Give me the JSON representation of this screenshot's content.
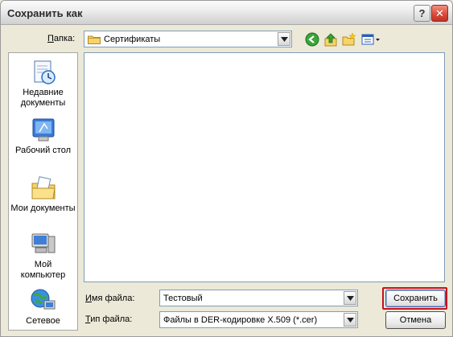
{
  "window": {
    "title": "Сохранить как"
  },
  "folder": {
    "label_prefix": "",
    "label_accel": "П",
    "label_rest": "апка:",
    "value": "Сертификаты"
  },
  "toolbar": {
    "icons": [
      "back-icon",
      "up-folder-icon",
      "new-folder-icon",
      "view-menu-icon"
    ]
  },
  "places": [
    {
      "label_line1": "Недавние",
      "label_line2": "документы",
      "icon": "recent-documents-icon"
    },
    {
      "label_line1": "Рабочий стол",
      "label_line2": "",
      "icon": "desktop-icon"
    },
    {
      "label_line1": "Мои документы",
      "label_line2": "",
      "icon": "my-documents-icon"
    },
    {
      "label_line1": "Мой",
      "label_line2": "компьютер",
      "icon": "my-computer-icon"
    },
    {
      "label_line1": "Сетевое",
      "label_line2": "",
      "icon": "network-icon"
    }
  ],
  "filename": {
    "label_accel": "И",
    "label_rest": "мя файла:",
    "value": "Тестовый"
  },
  "filetype": {
    "label_accel": "Т",
    "label_rest": "ип файла:",
    "value": "Файлы в DER-кодировке X.509 (*.cer)"
  },
  "buttons": {
    "save": "Сохранить",
    "cancel": "Отмена"
  },
  "colors": {
    "accent_highlight": "#c8101a",
    "title_text": "#2b2b2b"
  }
}
